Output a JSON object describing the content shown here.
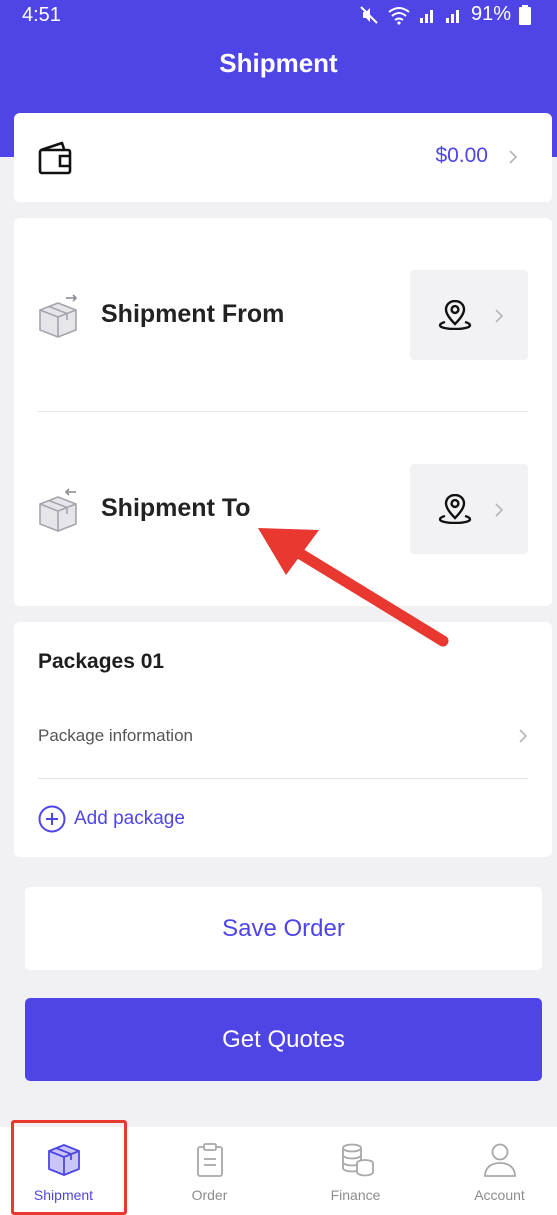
{
  "status_bar": {
    "time": "4:51",
    "battery": "91%"
  },
  "header": {
    "title": "Shipment"
  },
  "wallet": {
    "balance": "$0.00"
  },
  "route": {
    "from_label": "Shipment From",
    "to_label": "Shipment To"
  },
  "packages": {
    "title": "Packages 01",
    "info_label": "Package information",
    "add_label": "Add package"
  },
  "actions": {
    "save_label": "Save Order",
    "quotes_label": "Get Quotes"
  },
  "bottom_nav": {
    "items": [
      {
        "label": "Shipment",
        "icon": "box-icon",
        "active": true
      },
      {
        "label": "Order",
        "icon": "clipboard-icon",
        "active": false
      },
      {
        "label": "Finance",
        "icon": "coins-icon",
        "active": false
      },
      {
        "label": "Account",
        "icon": "person-icon",
        "active": false
      }
    ]
  },
  "colors": {
    "accent": "#4f45e6",
    "background": "#f1f1f3",
    "annotation": "#e8382f"
  }
}
